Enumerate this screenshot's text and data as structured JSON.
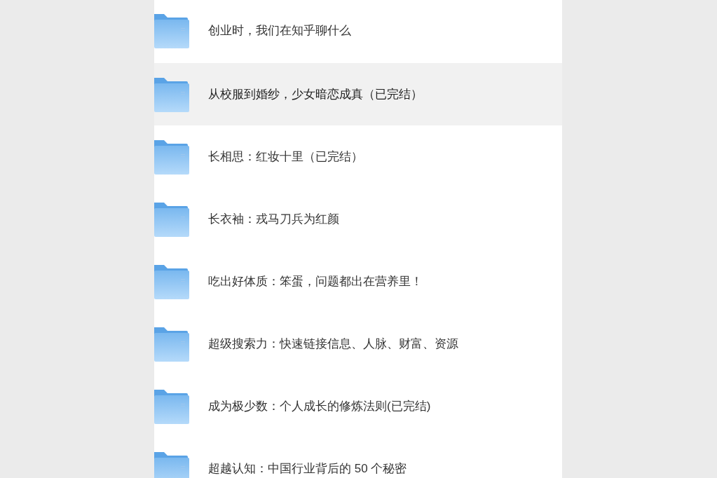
{
  "folders": [
    {
      "name": "创业时，我们在知乎聊什么",
      "selected": false
    },
    {
      "name": "从校服到婚纱，少女暗恋成真（已完结）",
      "selected": true
    },
    {
      "name": "长相思：红妆十里（已完结）",
      "selected": false
    },
    {
      "name": "长衣袖：戎马刀兵为红颜",
      "selected": false
    },
    {
      "name": "吃出好体质：笨蛋，问题都出在营养里！",
      "selected": false
    },
    {
      "name": "超级搜索力：快速链接信息、人脉、财富、资源",
      "selected": false
    },
    {
      "name": "成为极少数：个人成长的修炼法则(已完结)",
      "selected": false
    },
    {
      "name": "超越认知：中国行业背后的 50 个秘密",
      "selected": false
    }
  ]
}
